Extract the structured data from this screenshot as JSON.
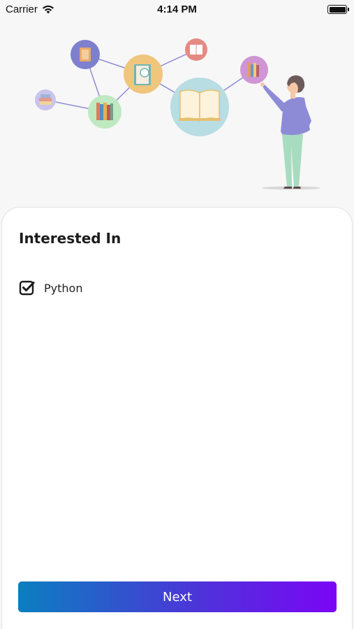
{
  "status_bar": {
    "carrier": "Carrier",
    "time": "4:14 PM",
    "icons": [
      "wifi-icon",
      "battery-icon"
    ]
  },
  "illustration": {
    "description_icon": "reading-network-illustration"
  },
  "interests": {
    "title": "Interested In",
    "options": [
      {
        "label": "Python",
        "checked": true
      }
    ]
  },
  "footer": {
    "next_label": "Next"
  },
  "colors": {
    "gradient_start": "#0b7fbf",
    "gradient_end": "#7b05f5",
    "card_bg": "#ffffff",
    "page_bg": "#f7f7f7"
  }
}
